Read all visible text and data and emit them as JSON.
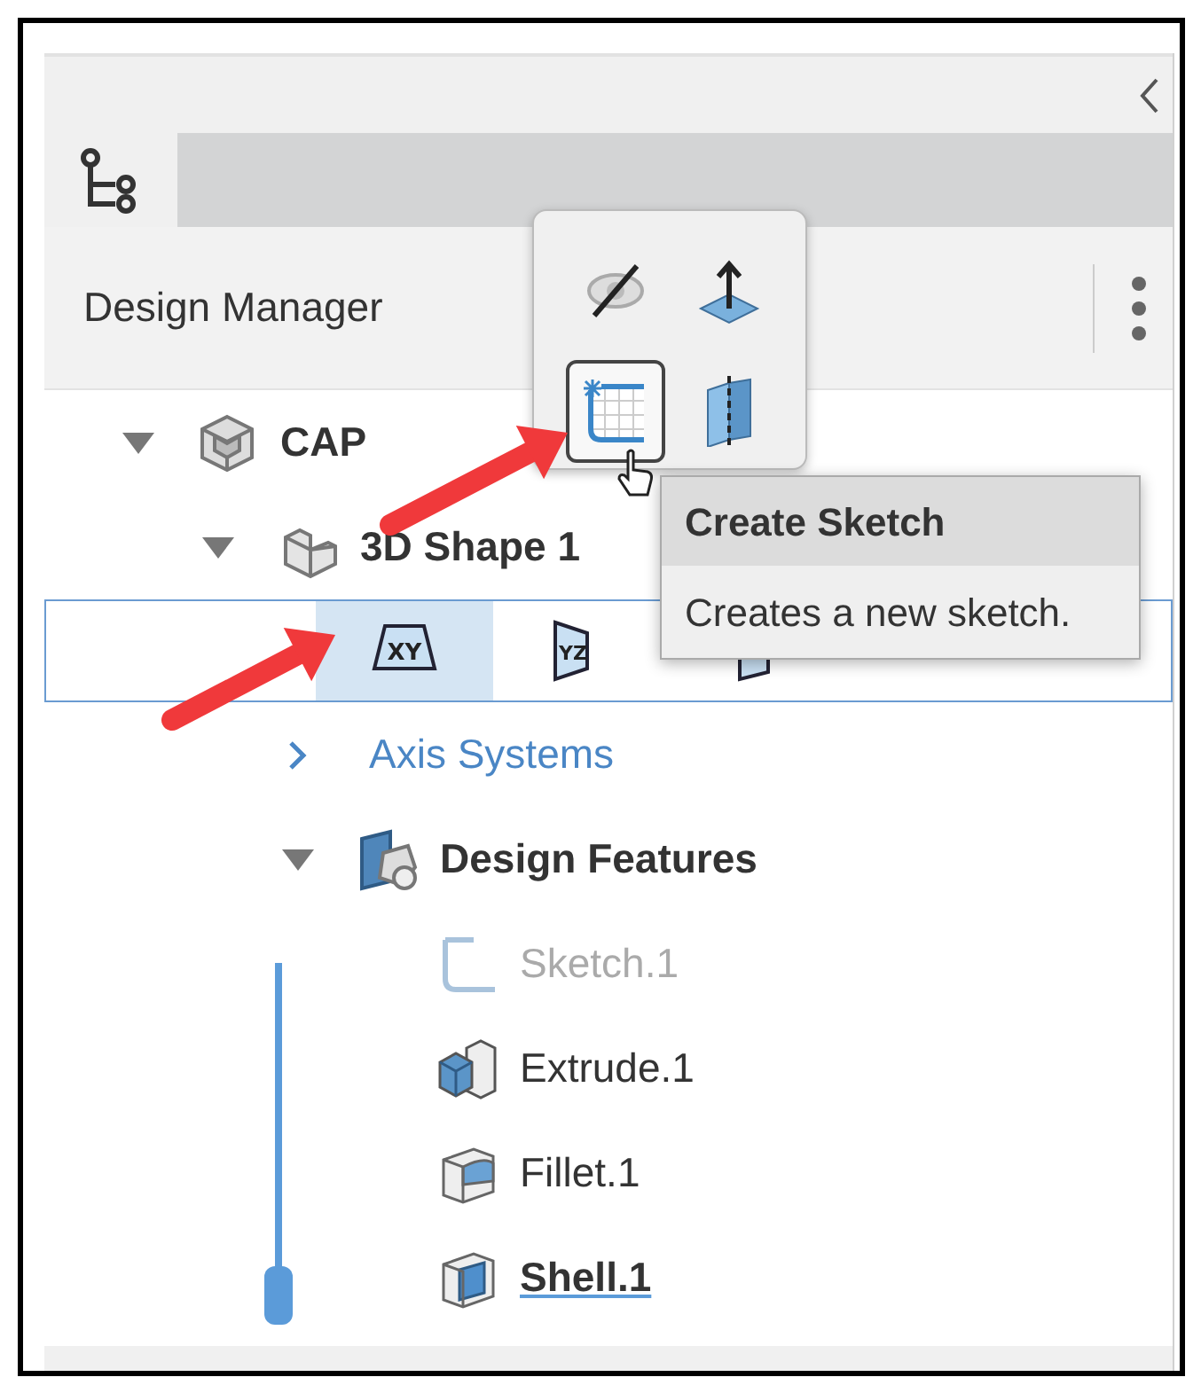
{
  "panel": {
    "header": {
      "title": "Design Manager"
    }
  },
  "tree": [
    {
      "label": "CAP",
      "kind": "product",
      "expanded": true,
      "children": [
        {
          "label": "3D Shape 1",
          "kind": "shape",
          "expanded": true,
          "plane_buttons": [
            {
              "label": "XY",
              "selected": true
            },
            {
              "label": "YZ",
              "selected": false
            },
            {
              "selected": false
            }
          ],
          "children": [
            {
              "label": "Axis Systems",
              "kind": "axis",
              "expanded": false
            },
            {
              "label": "Design Features",
              "kind": "features",
              "expanded": true,
              "children": [
                {
                  "label": "Sketch.1",
                  "kind": "sketch",
                  "disabled": true,
                  "current": false
                },
                {
                  "label": "Extrude.1",
                  "kind": "extrude",
                  "disabled": false,
                  "current": false
                },
                {
                  "label": "Fillet.1",
                  "kind": "fillet",
                  "disabled": false,
                  "current": false
                },
                {
                  "label": "Shell.1",
                  "kind": "shell",
                  "disabled": false,
                  "current": true
                }
              ]
            }
          ]
        }
      ]
    }
  ],
  "context_toolbar": [
    {
      "kind": "hide",
      "hovered": false
    },
    {
      "kind": "normal",
      "hovered": false
    },
    {
      "kind": "sketch",
      "hovered": true
    },
    {
      "kind": "split",
      "hovered": false
    }
  ],
  "tooltip": {
    "title": "Create Sketch",
    "text": "Creates a new sketch."
  }
}
